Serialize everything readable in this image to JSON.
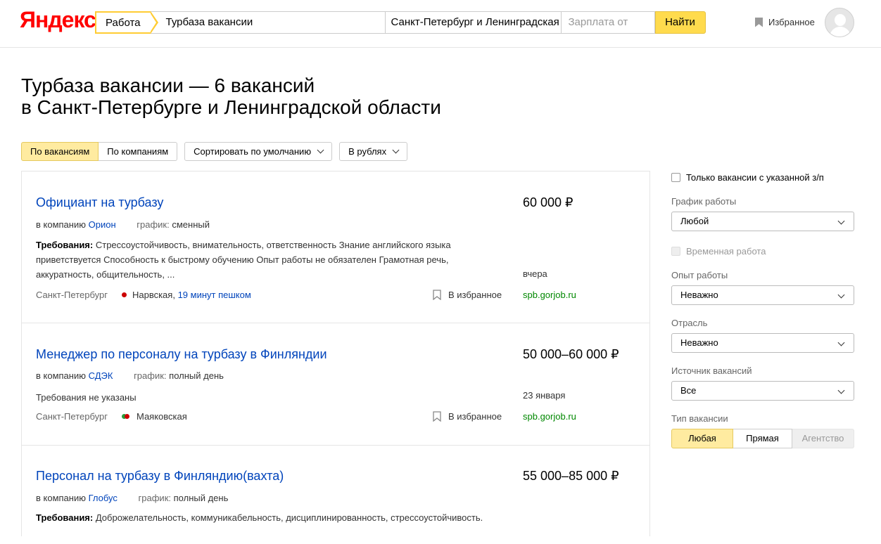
{
  "header": {
    "logo": "Яндекс",
    "search_tag": "Работа",
    "query": "Турбаза вакансии",
    "region": "Санкт-Петербург и Ленинградская",
    "salary_placeholder": "Зарплата от",
    "find_label": "Найти",
    "favorites_label": "Избранное"
  },
  "title": {
    "line1": "Турбаза вакансии — 6 вакансий",
    "line2": "в Санкт-Петербурге и Ленинградской области"
  },
  "controls": {
    "by_vacancies": "По вакансиям",
    "by_companies": "По компаниям",
    "sort": "Сортировать по умолчанию",
    "currency": "В рублях"
  },
  "vacancies": [
    {
      "title": "Официант на турбазу",
      "salary": "60 000 ₽",
      "company_prefix": "в компанию",
      "company": "Орион",
      "schedule_label": "график:",
      "schedule": "сменный",
      "req_label": "Требования:",
      "requirements": "Стрессоустойчивость, внимательность, ответственность Знание английского языка приветствуется Способность к быстрому обучению Опыт работы не обязателен Грамотная речь, аккуратность, общительность, ...",
      "date": "вчера",
      "city": "Санкт-Петербург",
      "metro": "Нарвская,",
      "walk": "19 минут пешком",
      "fav": "В избранное",
      "source": "spb.gorjob.ru"
    },
    {
      "title": "Менеджер по персоналу на турбазу в Финляндии",
      "salary": "50 000–60 000 ₽",
      "company_prefix": "в компанию",
      "company": "СДЭК",
      "schedule_label": "график:",
      "schedule": "полный день",
      "requirements": "Требования не указаны",
      "date": "23 января",
      "city": "Санкт-Петербург",
      "metro": "Маяковская",
      "fav": "В избранное",
      "source": "spb.gorjob.ru"
    },
    {
      "title": "Персонал на турбазу в Финляндию(вахта)",
      "salary": "55 000–85 000 ₽",
      "company_prefix": "в компанию",
      "company": "Глобус",
      "schedule_label": "график:",
      "schedule": "полный день",
      "req_label": "Требования:",
      "requirements": "Доброжелательность, коммуникабельность, дисциплинированность, стрессоустойчивость."
    }
  ],
  "sidebar": {
    "salary_only": "Только вакансии с указанной з/п",
    "schedule_label": "График работы",
    "schedule_value": "Любой",
    "temporary": "Временная работа",
    "experience_label": "Опыт работы",
    "experience_value": "Неважно",
    "industry_label": "Отрасль",
    "industry_value": "Неважно",
    "source_label": "Источник вакансий",
    "source_value": "Все",
    "type_label": "Тип вакансии",
    "type_any": "Любая",
    "type_direct": "Прямая",
    "type_agency": "Агентство"
  }
}
